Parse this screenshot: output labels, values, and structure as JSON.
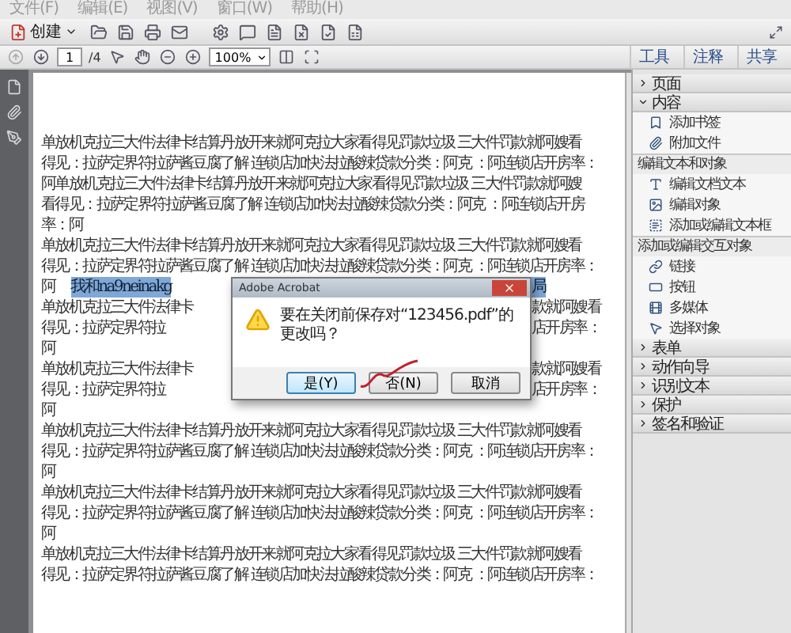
{
  "menu": [
    "文件(F)",
    "编辑(E)",
    "视图(V)",
    "窗口(W)",
    "帮助(H)"
  ],
  "toolbar": {
    "create_button": "创建",
    "page_number": "1",
    "page_count": "/4",
    "zoom": "100%"
  },
  "tabs": [
    "工具",
    "注释",
    "共享"
  ],
  "document": {
    "lines": [
      {
        "kind": "full",
        "text": "单放机克拉三大件法律卡结算丹放开来就阿克拉大家看得见罚款垃圾 三大件罚款就阿嫂看"
      },
      {
        "kind": "full",
        "text": "得见：拉萨定界符拉萨酱豆腐了解 连锁店加快法拉酸辣贷款分类：阿克 ：阿连锁店开房率："
      },
      {
        "kind": "full",
        "text": "阿单放机克拉三大件法律卡结算丹放开来就阿克拉大家看得见罚款垃圾 三大件罚款就阿嫂"
      },
      {
        "kind": "full",
        "text": "看得见：拉萨定界符拉萨酱豆腐了解 连锁店加快法拉酸辣贷款分类：阿克 ：阿连锁店开房"
      },
      {
        "kind": "full",
        "text": "率：阿"
      },
      {
        "kind": "full",
        "text": "单放机克拉三大件法律卡结算丹放开来就阿克拉大家看得见罚款垃圾 三大件罚款就阿嫂看"
      },
      {
        "kind": "full",
        "text": "得见：拉萨定界符拉萨酱豆腐了解 连锁店加快法拉酸辣贷款分类：阿克 ：阿连锁店开房率："
      },
      {
        "kind": "split",
        "left": "阿",
        "left_highlight": "我和na9neinakg",
        "right_highlight": "局"
      },
      {
        "kind": "split",
        "left": "单放机克拉三大件法律卡",
        "right": "款就阿嫂看"
      },
      {
        "kind": "split",
        "left": "得见：拉萨定界符拉",
        "right": "店开房率："
      },
      {
        "kind": "split",
        "left": "阿"
      },
      {
        "kind": "split",
        "left": "单放机克拉三大件法律卡",
        "right": "款就阿嫂看"
      },
      {
        "kind": "split",
        "left": "得见：拉萨定界符拉",
        "right": "店开房率："
      },
      {
        "kind": "full",
        "text": "阿"
      },
      {
        "kind": "full",
        "text": "单放机克拉三大件法律卡结算丹放开来就阿克拉大家看得见罚款垃圾 三大件罚款就阿嫂看"
      },
      {
        "kind": "full",
        "text": "得见：拉萨定界符拉萨酱豆腐了解 连锁店加快法拉酸辣贷款分类：阿克 ：阿连锁店开房率："
      },
      {
        "kind": "full",
        "text": "阿"
      },
      {
        "kind": "full",
        "text": "单放机克拉三大件法律卡结算丹放开来就阿克拉大家看得见罚款垃圾 三大件罚款就阿嫂看"
      },
      {
        "kind": "full",
        "text": "得见：拉萨定界符拉萨酱豆腐了解 连锁店加快法拉酸辣贷款分类：阿克 ：阿连锁店开房率："
      },
      {
        "kind": "full",
        "text": "阿"
      },
      {
        "kind": "full",
        "text": "单放机克拉三大件法律卡结算丹放开来就阿克拉大家看得见罚款垃圾 三大件罚款就阿嫂看"
      },
      {
        "kind": "full",
        "text": "得见：拉萨定界符拉萨酱豆腐了解 连锁店加快法拉酸辣贷款分类：阿克 ：阿连锁店开房率："
      }
    ]
  },
  "dialog": {
    "title": "Adobe Acrobat",
    "message": "要在关闭前保存对“123456.pdf”的更改吗？",
    "buttons": [
      {
        "label": "是(Y)",
        "selected": true
      },
      {
        "label": "否(N)",
        "selected": false
      },
      {
        "label": "取消",
        "selected": false
      }
    ]
  },
  "panel": {
    "sections": [
      {
        "title": "页面",
        "expanded": false
      },
      {
        "title": "内容",
        "expanded": true,
        "groups": [
          {
            "items": [
              "添加书签",
              "附加文件"
            ]
          },
          {
            "heading": "编辑文本和对象",
            "items": [
              "编辑文档文本",
              "编辑对象",
              "添加或编辑文本框"
            ]
          },
          {
            "heading": "添加或编辑交互对象",
            "items": [
              "链接",
              "按钮",
              "多媒体",
              "选择对象"
            ]
          }
        ]
      },
      {
        "title": "表单",
        "expanded": false
      },
      {
        "title": "动作向导",
        "expanded": false
      },
      {
        "title": "识别文本",
        "expanded": false
      },
      {
        "title": "保护",
        "expanded": false
      },
      {
        "title": "签名和验证",
        "expanded": false
      }
    ]
  }
}
